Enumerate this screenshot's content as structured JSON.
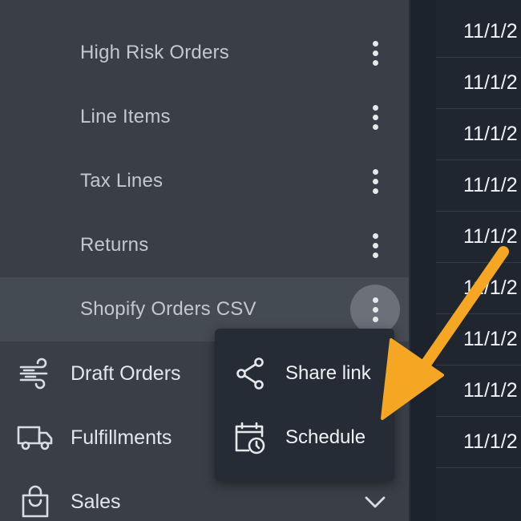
{
  "sidebar": {
    "sub_items": [
      {
        "label": "High Risk Orders"
      },
      {
        "label": "Line Items"
      },
      {
        "label": "Tax Lines"
      },
      {
        "label": "Returns"
      },
      {
        "label": "Shopify Orders CSV"
      }
    ],
    "main_items": [
      {
        "label": "Draft Orders",
        "icon": "wind-icon"
      },
      {
        "label": "Fulfillments",
        "icon": "truck-icon"
      },
      {
        "label": "Sales",
        "icon": "shopping-bag-icon"
      }
    ]
  },
  "context_menu": {
    "items": [
      {
        "label": "Share link",
        "icon": "share-icon"
      },
      {
        "label": "Schedule",
        "icon": "calendar-clock-icon"
      }
    ]
  },
  "table": {
    "dates": [
      "11/1/2",
      "11/1/2",
      "11/1/2",
      "11/1/2",
      "11/1/2",
      "11/1/2",
      "11/1/2",
      "11/1/2",
      "11/1/2"
    ]
  },
  "colors": {
    "sidebar_bg": "#3a3f47",
    "main_bg": "#1f2630",
    "menu_bg": "#252c36",
    "annotation_arrow": "#f5a623"
  }
}
